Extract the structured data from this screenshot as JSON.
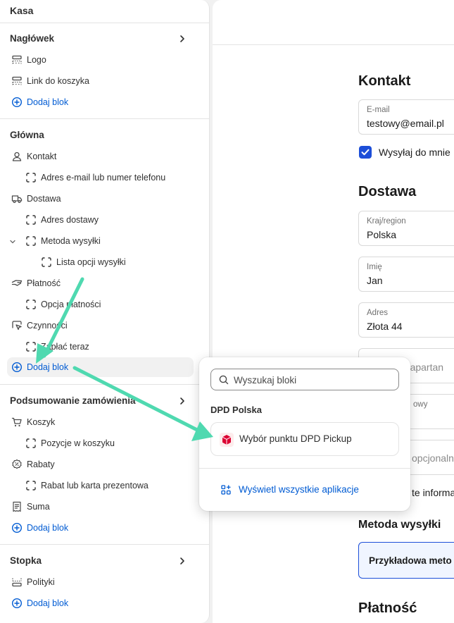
{
  "sidebar": {
    "title": "Kasa",
    "header": {
      "label": "Nagłówek",
      "items": [
        {
          "label": "Logo",
          "icon": "header-section-icon"
        },
        {
          "label": "Link do koszyka",
          "icon": "header-section-icon"
        }
      ],
      "add_label": "Dodaj blok"
    },
    "main": {
      "label": "Główna",
      "contact": "Kontakt",
      "contact_child": "Adres e-mail lub numer telefonu",
      "delivery": "Dostawa",
      "delivery_address": "Adres dostawy",
      "shipping_method": "Metoda wysyłki",
      "shipping_options": "Lista opcji wysyłki",
      "payment": "Płatność",
      "payment_option": "Opcja płatności",
      "actions": "Czynności",
      "pay_now": "Zapłać teraz",
      "add_label": "Dodaj blok"
    },
    "summary": {
      "label": "Podsumowanie zamówienia",
      "cart": "Koszyk",
      "cart_items": "Pozycje w koszyku",
      "discounts": "Rabaty",
      "discount_code": "Rabat lub karta prezentowa",
      "total": "Suma",
      "add_label": "Dodaj blok"
    },
    "footer": {
      "label": "Stopka",
      "policies": "Polityki",
      "add_label": "Dodaj blok"
    }
  },
  "preview": {
    "contact_title": "Kontakt",
    "email_label": "E-mail",
    "email_value": "testowy@email.pl",
    "newsletter_label": "Wysyłaj do mnie",
    "newsletter_checked": true,
    "delivery_title": "Dostawa",
    "country_label": "Kraj/region",
    "country_value": "Polska",
    "first_name_label": "Imię",
    "first_name_value": "Jan",
    "address_label": "Adres",
    "address_value": "Złota 44",
    "apartment_partial": "e, apartan",
    "postal_partial": "owy",
    "optional_partial": "opcjonalnie",
    "info_partial": "te informa",
    "shipping_method_title": "Metoda wysyłki",
    "shipping_option": "Przykładowa meto",
    "payment_title": "Płatność"
  },
  "popover": {
    "search_placeholder": "Wyszukaj bloki",
    "section_label": "DPD Polska",
    "app_label": "Wybór punktu DPD Pickup",
    "view_all_label": "Wyświetl wszystkie aplikacje"
  },
  "colors": {
    "accent": "#005bd3",
    "arrow": "#4fd9b0",
    "checkbox": "#1c4ed8",
    "dpd_red": "#dc0032"
  }
}
